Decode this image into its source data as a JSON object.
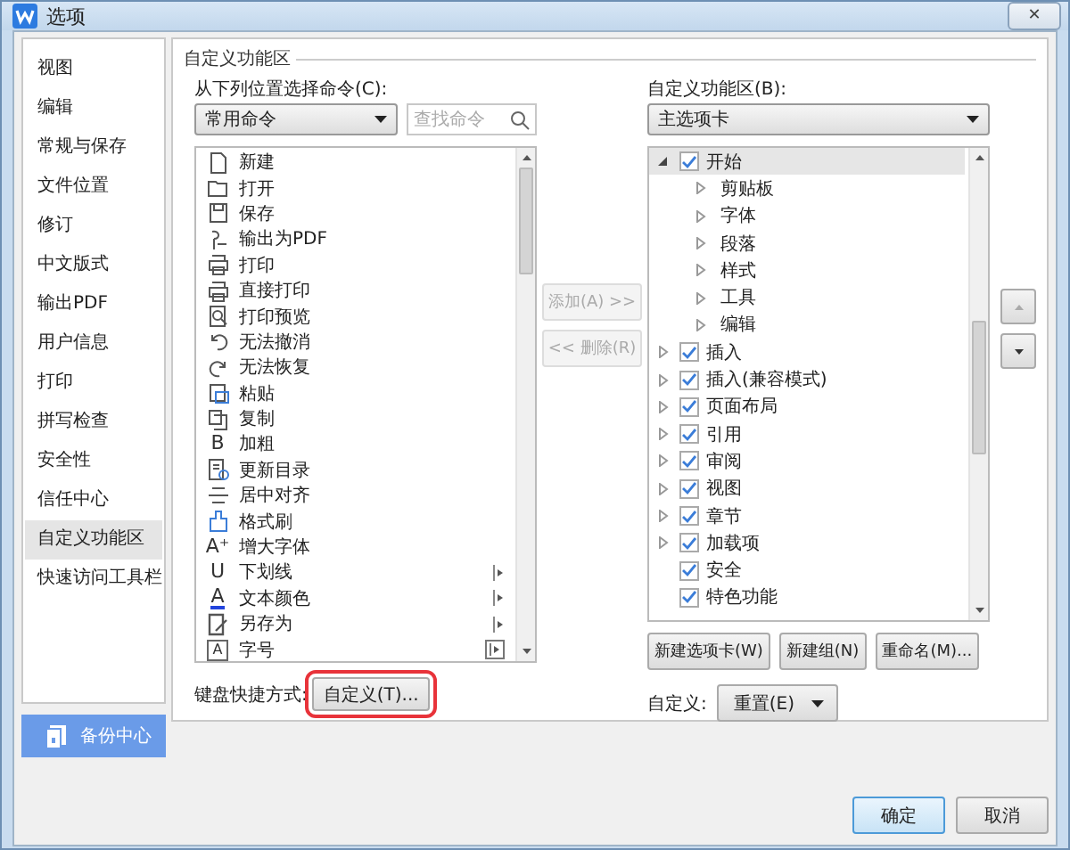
{
  "window": {
    "title": "选项",
    "close": "✕"
  },
  "sidebar": {
    "items": [
      {
        "label": "视图",
        "selected": false
      },
      {
        "label": "编辑",
        "selected": false
      },
      {
        "label": "常规与保存",
        "selected": false
      },
      {
        "label": "文件位置",
        "selected": false
      },
      {
        "label": "修订",
        "selected": false
      },
      {
        "label": "中文版式",
        "selected": false
      },
      {
        "label": "输出PDF",
        "selected": false
      },
      {
        "label": "用户信息",
        "selected": false
      },
      {
        "label": "打印",
        "selected": false
      },
      {
        "label": "拼写检查",
        "selected": false
      },
      {
        "label": "安全性",
        "selected": false
      },
      {
        "label": "信任中心",
        "selected": false
      },
      {
        "label": "自定义功能区",
        "selected": true
      },
      {
        "label": "快速访问工具栏",
        "selected": false
      }
    ],
    "backup_button": "备份中心"
  },
  "group_title": "自定义功能区",
  "commands": {
    "label": "从下列位置选择命令(C):",
    "dropdown": "常用命令",
    "search": {
      "placeholder": "查找命令"
    },
    "items": [
      {
        "label": "新建",
        "kind": "command"
      },
      {
        "label": "打开",
        "kind": "command"
      },
      {
        "label": "保存",
        "kind": "command"
      },
      {
        "label": "输出为PDF",
        "kind": "command"
      },
      {
        "label": "打印",
        "kind": "command"
      },
      {
        "label": "直接打印",
        "kind": "command"
      },
      {
        "label": "打印预览",
        "kind": "command"
      },
      {
        "label": "无法撤消",
        "kind": "command"
      },
      {
        "label": "无法恢复",
        "kind": "command"
      },
      {
        "label": "粘贴",
        "kind": "command"
      },
      {
        "label": "复制",
        "kind": "command"
      },
      {
        "label": "加粗",
        "kind": "command",
        "glyph": "B"
      },
      {
        "label": "更新目录",
        "kind": "command"
      },
      {
        "label": "居中对齐",
        "kind": "command"
      },
      {
        "label": "格式刷",
        "kind": "command"
      },
      {
        "label": "增大字体",
        "kind": "command",
        "glyph": "A⁺"
      },
      {
        "label": "下划线",
        "kind": "submenu",
        "glyph": "U"
      },
      {
        "label": "文本颜色",
        "kind": "submenu",
        "glyph": "A"
      },
      {
        "label": "另存为",
        "kind": "submenu"
      },
      {
        "label": "字号",
        "kind": "combo",
        "glyph": "A"
      }
    ],
    "shortcut_label": "键盘快捷方式:",
    "shortcut_button": "自定义(T)...",
    "shortcut_highlighted": true
  },
  "move_buttons": {
    "add": {
      "label": "添加(A) >>",
      "disabled": true
    },
    "remove": {
      "label": "<< 删除(R)",
      "disabled": true
    }
  },
  "ribbon": {
    "label": "自定义功能区(B):",
    "dropdown": "主选项卡",
    "tree": [
      {
        "label": "开始",
        "kind": "expandable",
        "expanded": true,
        "checked": true,
        "selected": true,
        "children": [
          {
            "label": "剪贴板"
          },
          {
            "label": "字体"
          },
          {
            "label": "段落"
          },
          {
            "label": "样式"
          },
          {
            "label": "工具"
          },
          {
            "label": "编辑"
          }
        ]
      },
      {
        "label": "插入",
        "kind": "expandable",
        "expanded": false,
        "checked": true,
        "selected": false
      },
      {
        "label": "插入(兼容模式)",
        "kind": "expandable",
        "expanded": false,
        "checked": true,
        "selected": false
      },
      {
        "label": "页面布局",
        "kind": "expandable",
        "expanded": false,
        "checked": true,
        "selected": false
      },
      {
        "label": "引用",
        "kind": "expandable",
        "expanded": false,
        "checked": true,
        "selected": false
      },
      {
        "label": "审阅",
        "kind": "expandable",
        "expanded": false,
        "checked": true,
        "selected": false
      },
      {
        "label": "视图",
        "kind": "expandable",
        "expanded": false,
        "checked": true,
        "selected": false
      },
      {
        "label": "章节",
        "kind": "expandable",
        "expanded": false,
        "checked": true,
        "selected": false
      },
      {
        "label": "加载项",
        "kind": "expandable",
        "expanded": false,
        "checked": true,
        "selected": false
      },
      {
        "label": "安全",
        "kind": "plain",
        "checked": true,
        "selected": false
      },
      {
        "label": "特色功能",
        "kind": "plain",
        "checked": true,
        "selected": false
      }
    ],
    "buttons": [
      "新建选项卡(W)",
      "新建组(N)",
      "重命名(M)..."
    ],
    "reset_label": "自定义:",
    "reset_button": "重置(E)"
  },
  "footer": {
    "ok": "确定",
    "cancel": "取消"
  }
}
